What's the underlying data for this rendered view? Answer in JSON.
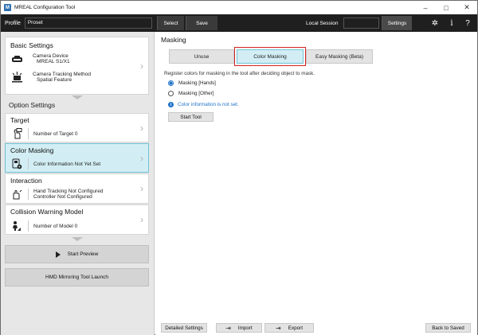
{
  "window": {
    "title": "MREAL Configuration Tool",
    "app_icon_letter": "M",
    "controls": {
      "minimize": "–",
      "maximize": "□",
      "close": "✕"
    }
  },
  "toolbar": {
    "profile_label": "Profile",
    "profile_value": "Proset",
    "select_label": "Select",
    "save_label": "Save",
    "local_session_label": "Local Session",
    "local_session_value": "",
    "settings_label": "Settings",
    "icons": {
      "gear": "✲",
      "info": "i",
      "help": "?"
    }
  },
  "left": {
    "basic_settings": {
      "title": "Basic Settings",
      "camera_device_label": "Camera Device",
      "camera_device_value": "MREAL S1/X1",
      "tracking_label": "Camera Tracking Method",
      "tracking_value": "Spatial Feature"
    },
    "option_settings_label": "Option Settings",
    "target": {
      "title": "Target",
      "row_text": "Number of Target 0"
    },
    "color_masking": {
      "title": "Color Masking",
      "row_text": "Color Information Not Yet Set"
    },
    "interaction": {
      "title": "Interaction",
      "row_line1": "Hand Tracking  Not Configured",
      "row_line2": "Controller  Not Configured"
    },
    "collision": {
      "title": "Collision Warning Model",
      "row_text": "Number of Model 0"
    },
    "start_preview_label": "Start Preview",
    "hmd_mirroring_label": "HMD Mirroring Tool Launch"
  },
  "right": {
    "section_title": "Masking",
    "tabs": [
      {
        "label": "Unuse"
      },
      {
        "label": "Color Masking"
      },
      {
        "label": "Easy Masking (Beta)"
      }
    ],
    "description": "Register colors for masking in the tool after deciding object to mask.",
    "radio_options": [
      {
        "label": "Masking [Hands]",
        "checked": true
      },
      {
        "label": "Masking [Other]",
        "checked": false
      }
    ],
    "info_text": "Color information is not set.",
    "start_tool_label": "Start Tool"
  },
  "bottom_bar": {
    "detailed_settings_label": "Detailed Settings",
    "import_label": "Import",
    "export_label": "Export",
    "back_to_saved_label": "Back to Saved"
  },
  "colors": {
    "toolbar_bg": "#1f1f1f",
    "selected_card_bg": "#d2eef4",
    "selected_border": "#6fc2d5",
    "highlight_red": "#d32020",
    "info_blue": "#1f72c9"
  }
}
